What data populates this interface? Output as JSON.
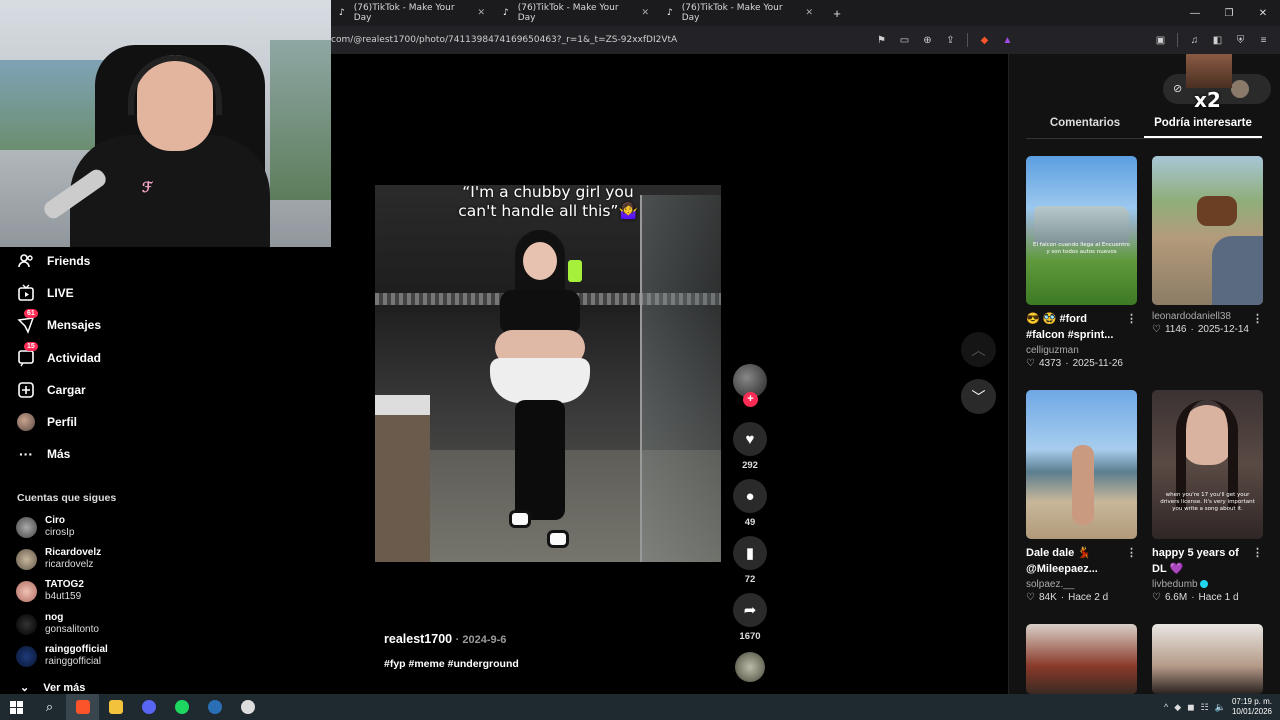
{
  "browser": {
    "tabs": [
      {
        "title": "(76)TikTok - Make Your Day"
      },
      {
        "title": "(76)TikTok - Make Your Day"
      },
      {
        "title": "(76)TikTok - Make Your Day"
      }
    ],
    "url": "com/@realest1700/photo/7411398474169650463?_r=1&_t=ZS-92xxfDI2VtA"
  },
  "sidebar": {
    "nav": [
      {
        "label": "Friends",
        "icon": "friends-icon"
      },
      {
        "label": "LIVE",
        "icon": "live-icon"
      },
      {
        "label": "Mensajes",
        "icon": "messages-icon",
        "badge": "61"
      },
      {
        "label": "Actividad",
        "icon": "activity-icon",
        "badge": "15"
      },
      {
        "label": "Cargar",
        "icon": "upload-icon"
      },
      {
        "label": "Perfil",
        "icon": "profile-avatar"
      },
      {
        "label": "Más",
        "icon": "more-icon"
      }
    ],
    "following_title": "Cuentas que sigues",
    "following": [
      {
        "name": "Ciro",
        "handle": "cirosIp"
      },
      {
        "name": "Ricardovelz",
        "handle": "ricardovelz"
      },
      {
        "name": "TATOG2",
        "handle": "b4ut159"
      },
      {
        "name": "nog",
        "handle": "gonsalitonto"
      },
      {
        "name": "rainggofficial",
        "handle": "rainggofficial"
      }
    ],
    "see_more": "Ver más"
  },
  "post": {
    "caption_line1": "“I'm a chubby girl you",
    "caption_line2": "can't handle all this”",
    "author": "realest1700",
    "date": "2024-9-6",
    "tags": "#fyp #meme #underground",
    "likes": "292",
    "comments": "49",
    "saves": "72",
    "shares": "1670"
  },
  "overlay": {
    "multiplier": "x2"
  },
  "right_panel": {
    "tabs": [
      "Comentarios",
      "Podría interesarte"
    ],
    "active_tab": 1,
    "cards": [
      {
        "title_line1": "😎 🥸 #ford",
        "title_line2": "#falcon #sprint...",
        "user": "celliguzman",
        "likes": "4373",
        "date": "2025-11-26",
        "thumb_text": "El falcon cuando llega al Encuentro y son todos autos nuevos"
      },
      {
        "title_line1": "",
        "title_line2": "",
        "user": "leonardodaniell38",
        "likes": "1146",
        "date": "2025-12-14",
        "thumb_text": ""
      },
      {
        "title_line1": "Dale dale 💃",
        "title_line2": "@Mileepaez...",
        "user": "solpaez.__",
        "likes": "84K",
        "date": "Hace 2 d",
        "thumb_text": ""
      },
      {
        "title_line1": "happy 5 years of",
        "title_line2": "DL 💜",
        "user": "livbedumb",
        "likes": "6.6M",
        "date": "Hace 1 d",
        "thumb_text": "when you're 17 you'll get your drivers license. It's very important you write a song about it."
      }
    ]
  },
  "taskbar": {
    "time": "07:19 p. m.",
    "date": "10/01/2026"
  }
}
